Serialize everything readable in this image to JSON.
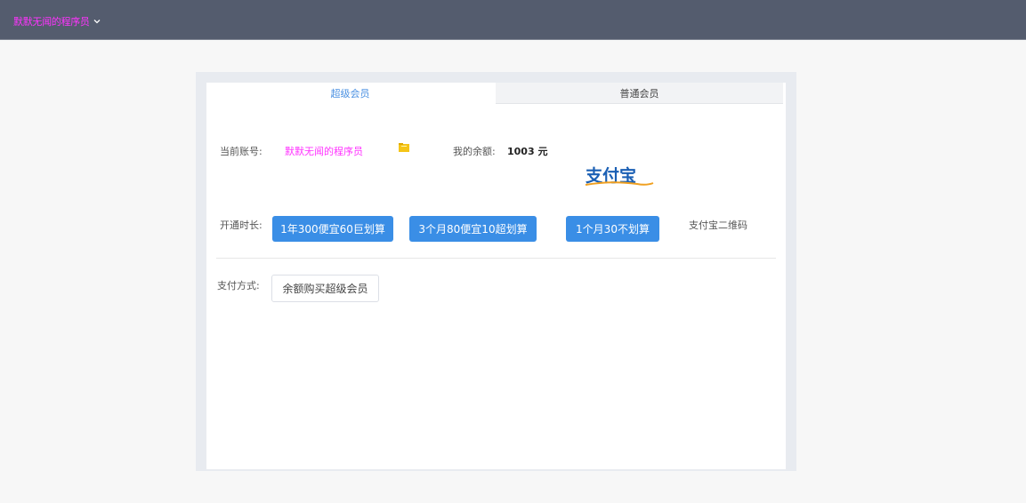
{
  "header": {
    "username": "默默无闻的程序员",
    "menu_icon": "chevron-down-icon"
  },
  "tabs": [
    {
      "label": "超级会员",
      "active": true
    },
    {
      "label": "普通会员",
      "active": false
    }
  ],
  "account": {
    "label": "当前账号:",
    "name": "默默无闻的程序员",
    "icon": "folder-icon"
  },
  "balance": {
    "label": "我的余额:",
    "value": "1003 元"
  },
  "alipay": {
    "logo_text": "支付宝"
  },
  "duration": {
    "label": "开通时长:",
    "options": [
      "1年300便宜60巨划算",
      "3个月80便宜10超划算",
      "1个月30不划算"
    ],
    "qr_label": "支付宝二维码"
  },
  "payment": {
    "label": "支付方式:",
    "button": "余额购买超级会员"
  },
  "colors": {
    "header_bg": "#545c6e",
    "username": "#ff33ff",
    "primary": "#3a8ee6",
    "tab_active_text": "#4a90e2",
    "alipay_blue": "#1a5fb4",
    "alipay_orange": "#f0a020"
  }
}
